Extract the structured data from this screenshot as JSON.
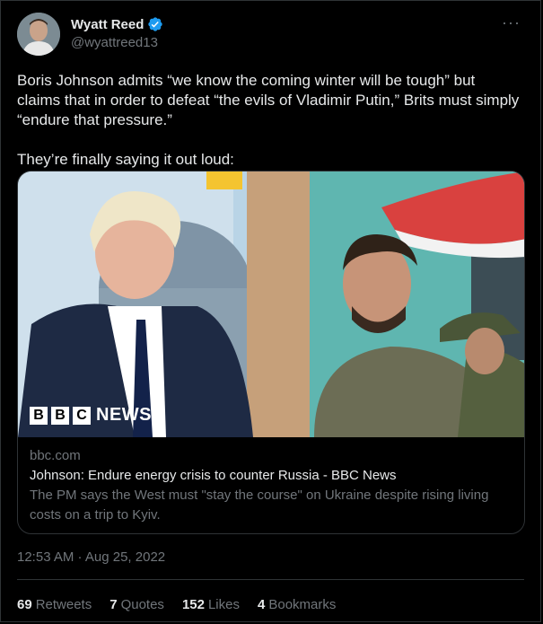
{
  "author": {
    "name": "Wyatt Reed",
    "handle": "@wyattreed13",
    "verified": true,
    "verified_color": "#1d9bf0"
  },
  "tweet": {
    "text": "Boris Johnson admits “we know the coming winter will be tough” but claims that in order to defeat “the evils of Vladimir Putin,” Brits must simply “endure that pressure.”\n\nThey’re finally saying it out loud:",
    "timestamp": "12:53 AM · Aug 25, 2022"
  },
  "card": {
    "logo_letters": [
      "B",
      "B",
      "C"
    ],
    "logo_word": "NEWS",
    "domain": "bbc.com",
    "title": "Johnson: Endure energy crisis to counter Russia - BBC News",
    "description": "The PM says the West must \"stay the course\" on Ukraine despite rising living costs on a trip to Kyiv."
  },
  "stats": {
    "retweets_count": "69",
    "retweets_label": "Retweets",
    "quotes_count": "7",
    "quotes_label": "Quotes",
    "likes_count": "152",
    "likes_label": "Likes",
    "bookmarks_count": "4",
    "bookmarks_label": "Bookmarks"
  },
  "icons": {
    "more": "more-horizontal-icon",
    "verified": "verified-badge-icon"
  },
  "colors": {
    "background": "#000000",
    "text_primary": "#e7e9ea",
    "text_secondary": "#71767b",
    "border": "#2f3336"
  }
}
